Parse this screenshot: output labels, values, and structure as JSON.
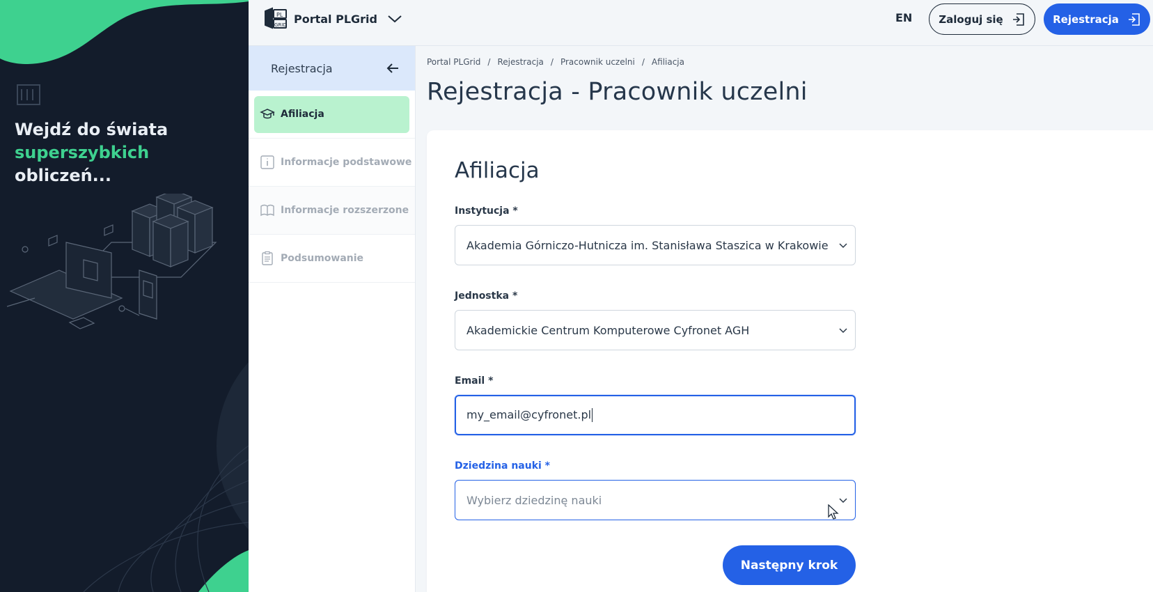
{
  "hero": {
    "headline_line1": "Wejdź do świata",
    "headline_accent": "superszybkich",
    "headline_line3": "obliczeń...",
    "accent_color": "#3ed18f",
    "background_color": "#131c2b"
  },
  "header": {
    "brand_name": "Portal PLGrid",
    "brand_menu_icon": "chevron-down-icon",
    "language": "EN",
    "login_label": "Zaloguj się",
    "register_label": "Rejestracja",
    "brand_color": "#2461e6"
  },
  "stepper": {
    "title": "Rejestracja",
    "collapse_icon": "arrow-left-icon",
    "steps": [
      {
        "label": "Afiliacja",
        "icon": "graduation-cap-icon",
        "state": "active"
      },
      {
        "label": "Informacje podstawowe",
        "icon": "info-icon",
        "state": "disabled"
      },
      {
        "label": "Informacje rozszerzone",
        "icon": "book-icon",
        "state": "disabled"
      },
      {
        "label": "Podsumowanie",
        "icon": "clipboard-icon",
        "state": "disabled"
      }
    ]
  },
  "breadcrumb": [
    "Portal PLGrid",
    "Rejestracja",
    "Pracownik uczelni",
    "Afiliacja"
  ],
  "page_title": "Rejestracja - Pracownik uczelni",
  "form": {
    "section_title": "Afiliacja",
    "institution": {
      "label": "Instytucja *",
      "value": "Akademia Górniczo-Hutnicza im. Stanisława Staszica w Krakowie"
    },
    "unit": {
      "label": "Jednostka *",
      "value": "Akademickie Centrum Komputerowe Cyfronet AGH"
    },
    "email": {
      "label": "Email *",
      "value": "my_email@cyfronet.pl"
    },
    "science_field": {
      "label": "Dziedzina nauki *",
      "placeholder": "Wybierz dziedzinę nauki"
    },
    "next_label": "Następny krok"
  }
}
